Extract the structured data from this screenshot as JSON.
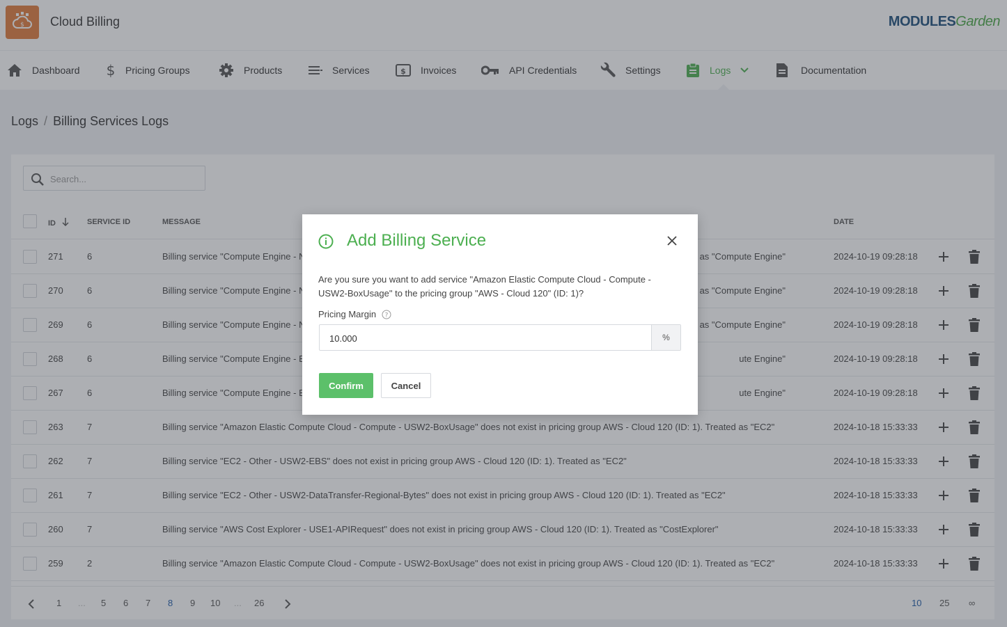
{
  "app": {
    "title": "Cloud Billing",
    "brand_main": "MODULES",
    "brand_accent": "Garden"
  },
  "nav": {
    "items": [
      {
        "label": "Dashboard",
        "icon": "home-icon"
      },
      {
        "label": "Pricing Groups",
        "icon": "dollar-icon"
      },
      {
        "label": "Products",
        "icon": "gear-icon"
      },
      {
        "label": "Services",
        "icon": "list-icon"
      },
      {
        "label": "Invoices",
        "icon": "invoice-icon"
      },
      {
        "label": "API Credentials",
        "icon": "key-icon"
      },
      {
        "label": "Settings",
        "icon": "wrench-icon"
      },
      {
        "label": "Logs",
        "icon": "clipboard-icon",
        "active": true
      },
      {
        "label": "Documentation",
        "icon": "document-icon"
      }
    ]
  },
  "breadcrumb": {
    "parent": "Logs",
    "separator": "/",
    "current": "Billing Services Logs"
  },
  "search": {
    "placeholder": "Search..."
  },
  "table": {
    "columns": {
      "id": "ID",
      "service_id": "SERVICE ID",
      "message": "MESSAGE",
      "date": "DATE"
    },
    "rows": [
      {
        "id": "271",
        "service_id": "6",
        "message": "Billing service \"Compute Engine - N",
        "message_tail": "as \"Compute Engine\"",
        "date": "2024-10-19 09:28:18"
      },
      {
        "id": "270",
        "service_id": "6",
        "message": "Billing service \"Compute Engine - N",
        "message_tail": "as \"Compute Engine\"",
        "date": "2024-10-19 09:28:18"
      },
      {
        "id": "269",
        "service_id": "6",
        "message": "Billing service \"Compute Engine - N",
        "message_tail": "as \"Compute Engine\"",
        "date": "2024-10-19 09:28:18"
      },
      {
        "id": "268",
        "service_id": "6",
        "message": "Billing service \"Compute Engine - E",
        "message_tail": "ute Engine\"",
        "date": "2024-10-19 09:28:18"
      },
      {
        "id": "267",
        "service_id": "6",
        "message": "Billing service \"Compute Engine - E",
        "message_tail": "ute Engine\"",
        "date": "2024-10-19 09:28:18"
      },
      {
        "id": "263",
        "service_id": "7",
        "message": "Billing service \"Amazon Elastic Compute Cloud - Compute - USW2-BoxUsage\" does not exist in pricing group AWS - Cloud 120 (ID: 1). Treated as \"EC2\"",
        "message_tail": "",
        "date": "2024-10-18 15:33:33"
      },
      {
        "id": "262",
        "service_id": "7",
        "message": "Billing service \"EC2 - Other - USW2-EBS\" does not exist in pricing group AWS - Cloud 120 (ID: 1). Treated as \"EC2\"",
        "message_tail": "",
        "date": "2024-10-18 15:33:33"
      },
      {
        "id": "261",
        "service_id": "7",
        "message": "Billing service \"EC2 - Other - USW2-DataTransfer-Regional-Bytes\" does not exist in pricing group AWS - Cloud 120 (ID: 1). Treated as \"EC2\"",
        "message_tail": "",
        "date": "2024-10-18 15:33:33"
      },
      {
        "id": "260",
        "service_id": "7",
        "message": "Billing service \"AWS Cost Explorer - USE1-APIRequest\" does not exist in pricing group AWS - Cloud 120 (ID: 1). Treated as \"CostExplorer\"",
        "message_tail": "",
        "date": "2024-10-18 15:33:33"
      },
      {
        "id": "259",
        "service_id": "2",
        "message": "Billing service \"Amazon Elastic Compute Cloud - Compute - USW2-BoxUsage\" does not exist in pricing group AWS - Cloud 120 (ID: 1). Treated as \"EC2\"",
        "message_tail": "",
        "date": "2024-10-18 15:33:33"
      }
    ]
  },
  "pagination": {
    "pages": [
      "1",
      "...",
      "5",
      "6",
      "7",
      "8",
      "9",
      "10",
      "...",
      "26"
    ],
    "current": "8",
    "per_page_options": [
      "10",
      "25",
      "∞"
    ],
    "per_page_selected": "10"
  },
  "modal": {
    "title": "Add Billing Service",
    "message": "Are you sure you want to add service \"Amazon Elastic Compute Cloud - Compute - USW2-BoxUsage\" to the pricing group \"AWS - Cloud 120\" (ID: 1)?",
    "field_label": "Pricing Margin",
    "field_value": "10.000",
    "field_addon": "%",
    "confirm_label": "Confirm",
    "cancel_label": "Cancel"
  },
  "colors": {
    "accent_green": "#4caf50",
    "brand_orange": "#e07b3c",
    "link_blue": "#1e5aa8"
  }
}
